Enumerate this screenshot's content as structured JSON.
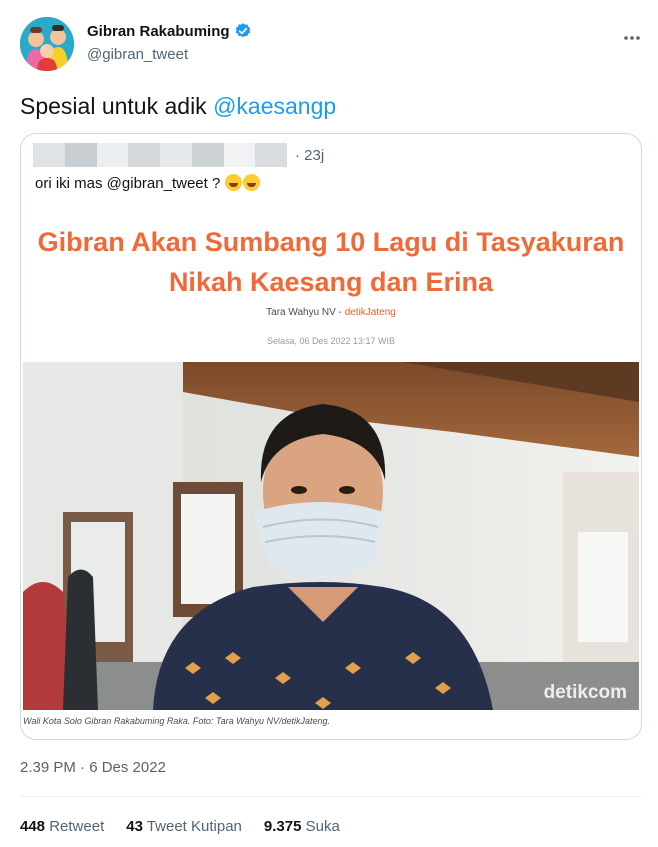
{
  "author": {
    "display_name": "Gibran Rakabuming",
    "handle": "@gibran_tweet",
    "avatar_icon": "avatar-photo",
    "verified_icon": "verified-badge-icon",
    "more_icon": "more-options-icon"
  },
  "tweet": {
    "text_prefix": "Spesial untuk adik ",
    "mention": "@kaesangp"
  },
  "quoted": {
    "time": "· 23j",
    "text": "ori iki mas @gibran_tweet ?",
    "emoji": "face-with-tears-of-joy",
    "article": {
      "headline_line1": "Gibran Akan Sumbang 10 Lagu di Tasyakuran",
      "headline_line2": "Nikah Kaesang dan Erina",
      "byline_author": "Tara Wahyu NV - ",
      "byline_source": "detikJateng",
      "date": "Selasa, 06 Des 2022 13:17 WIB",
      "caption": "Wali Kota Solo Gibran Rakabuming Raka. Foto: Tara Wahyu NV/detikJateng.",
      "watermark": "detikcom"
    }
  },
  "timestamp": "2.39 PM · 6 Des 2022",
  "stats": {
    "retweets_num": "448",
    "retweets_label": "Retweet",
    "quotes_num": "43",
    "quotes_label": "Tweet Kutipan",
    "likes_num": "9.375",
    "likes_label": "Suka"
  },
  "colors": {
    "accent": "#1d9bf0",
    "headline": "#f06a39",
    "text_secondary": "#536471"
  }
}
